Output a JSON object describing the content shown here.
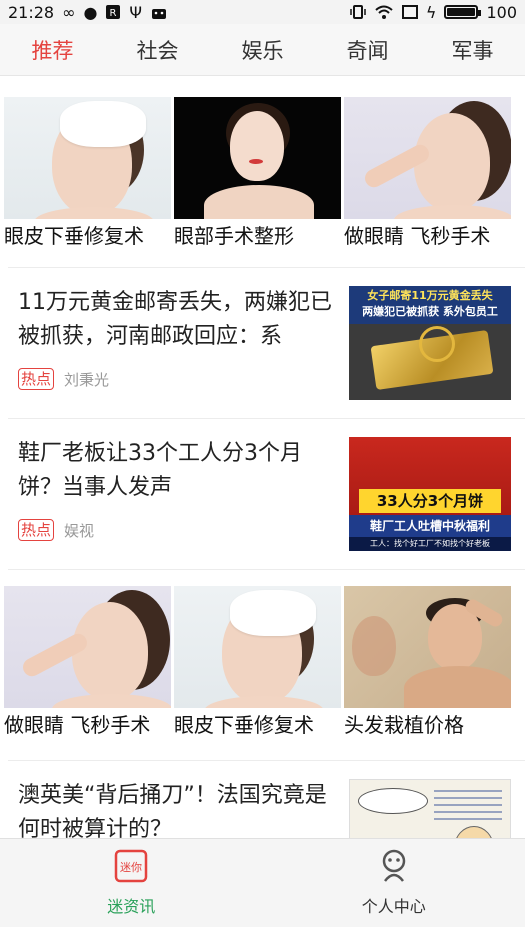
{
  "status_bar": {
    "time": "21:28",
    "battery_text": "100",
    "battery_level": 1.0
  },
  "tabs": [
    {
      "label": "推荐",
      "active": true
    },
    {
      "label": "社会",
      "active": false
    },
    {
      "label": "娱乐",
      "active": false
    },
    {
      "label": "奇闻",
      "active": false
    },
    {
      "label": "军事",
      "active": false
    }
  ],
  "feed": {
    "ad_row_1": [
      {
        "caption": "眼皮下垂修复术",
        "image": "woman-headband"
      },
      {
        "caption": "眼部手术整形",
        "image": "woman-black-background"
      },
      {
        "caption": "做眼睛 飞秒手术",
        "image": "woman-finger-nose"
      }
    ],
    "news_1": {
      "title": "11万元黄金邮寄丢失，两嫌犯已被抓获，河南邮政回应：系",
      "tag": "热点",
      "source": "刘秉光",
      "thumb_line1": "女子邮寄11万元黄金丢失",
      "thumb_line2": "两嫌犯已被抓获 系外包员工"
    },
    "news_2": {
      "title": "鞋厂老板让33个工人分3个月饼？当事人发声",
      "tag": "热点",
      "source": "娱视",
      "thumb_main": "33人分3个月饼",
      "thumb_sub": "鞋厂工人吐槽中秋福利",
      "thumb_foot": "工人：找个好工厂不如找个好老板"
    },
    "ad_row_2": [
      {
        "caption": "做眼睛 飞秒手术",
        "image": "woman-finger-nose"
      },
      {
        "caption": "眼皮下垂修复术",
        "image": "woman-headband"
      },
      {
        "caption": "头发栽植价格",
        "image": "man-hair-mirror"
      }
    ],
    "news_3": {
      "title": "澳英美“背后捅刀”！法国究竟是何时被算计的？"
    }
  },
  "bottom_nav": [
    {
      "label": "迷资讯",
      "icon_text": "迷你",
      "active": true
    },
    {
      "label": "个人中心",
      "active": false
    }
  ],
  "colors": {
    "accent_red": "#e4433f",
    "nav_green": "#2aa15a"
  }
}
